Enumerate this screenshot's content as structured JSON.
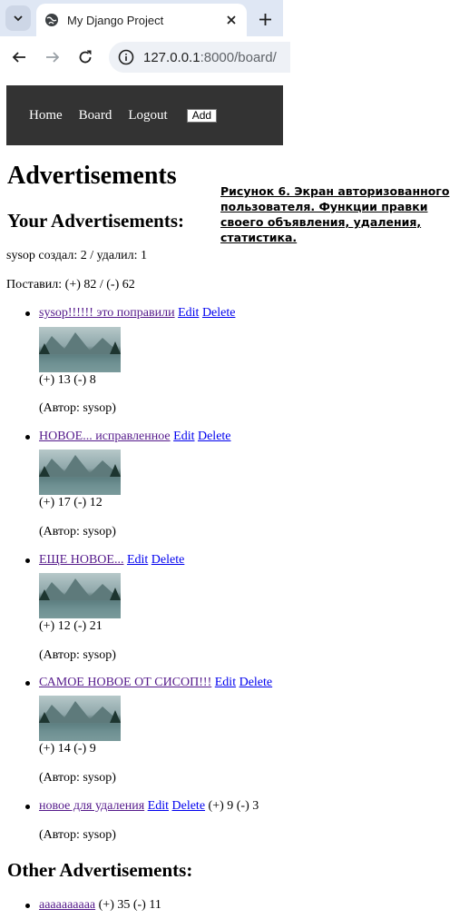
{
  "browser": {
    "tab_title": "My Django Project",
    "url_host": "127.0.0.1",
    "url_rest": ":8000/board/"
  },
  "nav": {
    "home": "Home",
    "board": "Board",
    "logout": "Logout",
    "add": "Add"
  },
  "page": {
    "title": "Advertisements",
    "your_heading": "Your Advertisements:",
    "created_stat": "sysop создал: 2 / удалил: 1",
    "votes_stat": "Поставил: (+) 82 / (-) 62",
    "other_heading": "Other Advertisements:"
  },
  "caption": "Рисунок 6. Экран авторизованного пользователя. Функции правки своего объявления, удаления, статистика.",
  "my_ads": [
    {
      "title": "sysop!!!!!! это поправили",
      "edit": "Edit",
      "delete": "Delete",
      "votes": "(+) 13 (-) 8",
      "author": "(Автор: sysop)",
      "has_image": true
    },
    {
      "title": "НОВОЕ... исправленное",
      "edit": "Edit",
      "delete": "Delete",
      "votes": "(+) 17 (-) 12",
      "author": "(Автор: sysop)",
      "has_image": true
    },
    {
      "title": "ЕЩЕ НОВОЕ...",
      "edit": "Edit",
      "delete": "Delete",
      "votes": "(+) 12 (-) 21",
      "author": "(Автор: sysop)",
      "has_image": true
    },
    {
      "title": "САМОЕ НОВОЕ ОТ СИСОП!!!",
      "edit": "Edit",
      "delete": "Delete",
      "votes": "(+) 14 (-) 9",
      "author": "(Автор: sysop)",
      "has_image": true
    },
    {
      "title": "новое для удаления",
      "edit": "Edit",
      "delete": "Delete",
      "votes": "(+) 9 (-) 3",
      "author": "(Автор: sysop)",
      "has_image": false
    }
  ],
  "other_ads": [
    {
      "title": "aaaaaaaaaa",
      "votes": "(+) 35 (-) 11"
    }
  ]
}
